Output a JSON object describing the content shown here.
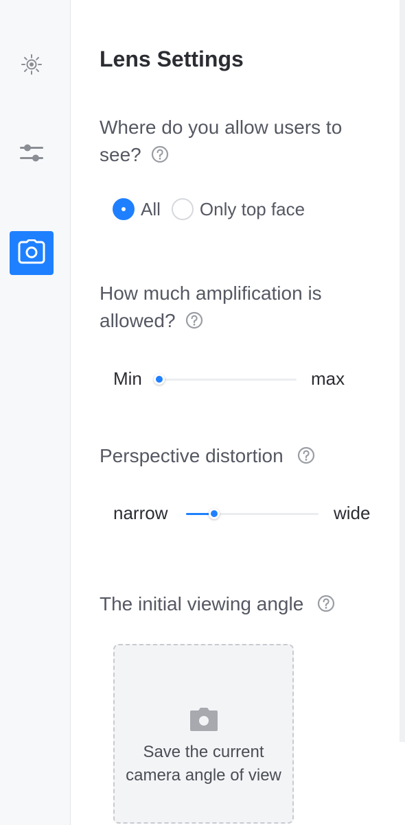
{
  "sidebar": {
    "items": [
      {
        "name": "sun-icon",
        "active": false
      },
      {
        "name": "sliders-icon",
        "active": false
      },
      {
        "name": "camera-icon",
        "active": true
      }
    ]
  },
  "panel": {
    "title": "Lens Settings",
    "visibility": {
      "question_line1": "Where do you allow users to",
      "question_line2": "see?",
      "options": [
        {
          "label": "All",
          "checked": true
        },
        {
          "label": "Only top face",
          "checked": false
        }
      ]
    },
    "amplification": {
      "question_line1": "How much amplification is",
      "question_line2": "allowed?",
      "min_label": "Min",
      "max_label": "max",
      "value_fraction": 0.0
    },
    "distortion": {
      "question": "Perspective distortion",
      "min_label": "narrow",
      "max_label": "wide",
      "value_fraction": 0.21
    },
    "initial_angle": {
      "question": "The initial viewing angle",
      "capture_line1": "Save the current",
      "capture_line2": "camera angle of view"
    }
  },
  "colors": {
    "accent": "#1e80ff",
    "sidebar_bg": "#f7f8fa",
    "icon_gray": "#8a8d93"
  }
}
